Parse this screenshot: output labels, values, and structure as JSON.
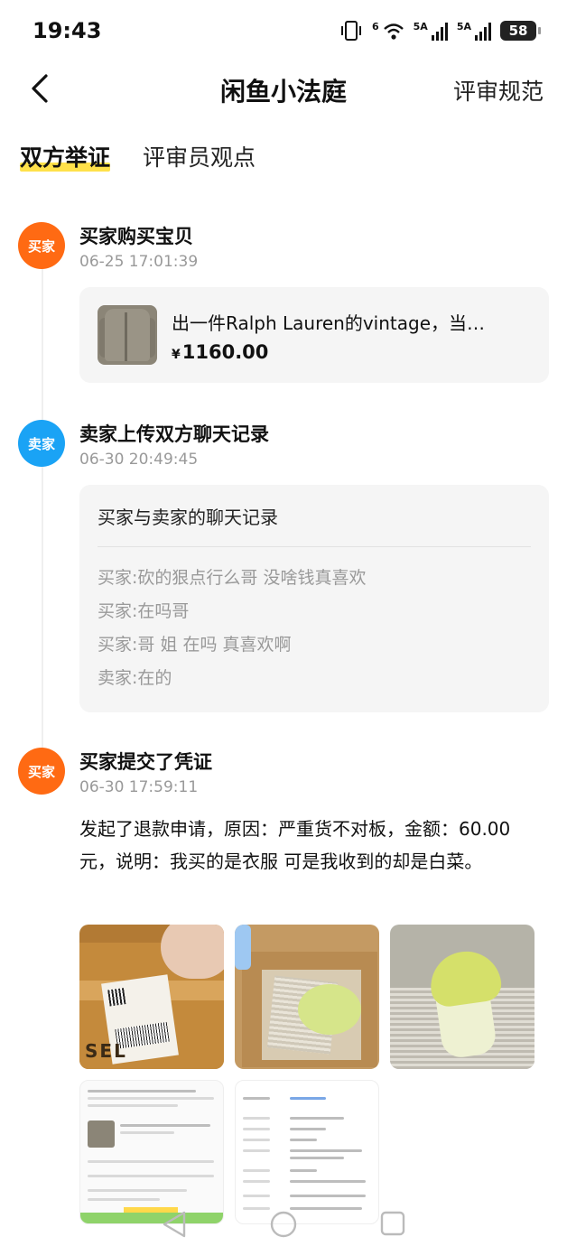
{
  "status_bar": {
    "time": "19:43",
    "network_1": "5A",
    "network_2": "5A",
    "wifi_label": "6",
    "battery": "58"
  },
  "nav": {
    "title": "闲鱼小法庭",
    "right_link": "评审规范"
  },
  "tabs": [
    {
      "label": "双方举证",
      "active": true
    },
    {
      "label": "评审员观点",
      "active": false
    }
  ],
  "events": [
    {
      "role": "买家",
      "title": "买家购买宝贝",
      "time": "06-25 17:01:39",
      "product": {
        "title": "出一件Ralph Lauren的vintage，当…",
        "currency": "¥",
        "price": "1160.00"
      }
    },
    {
      "role": "卖家",
      "title": "卖家上传双方聊天记录",
      "time": "06-30 20:49:45",
      "chat": {
        "title": "买家与卖家的聊天记录",
        "lines": [
          "买家:砍的狠点行么哥 没啥钱真喜欢",
          "买家:在吗哥",
          "买家:哥 姐 在吗 真喜欢啊",
          "卖家:在的"
        ]
      }
    },
    {
      "role": "买家",
      "title": "买家提交了凭证",
      "time": "06-30 17:59:11",
      "description": "发起了退款申请，原因：严重货不对板，金额：60.00元，说明：我买的是衣服 可是我收到的却是白菜。",
      "photos": [
        "package-label-photo",
        "box-with-cabbage-photo",
        "cabbage-photo",
        "order-screenshot",
        "transaction-detail-screenshot"
      ]
    }
  ],
  "colors": {
    "buyer_badge": "#ff6a13",
    "seller_badge": "#1aa3f5",
    "tab_highlight": "#ffe14a"
  }
}
